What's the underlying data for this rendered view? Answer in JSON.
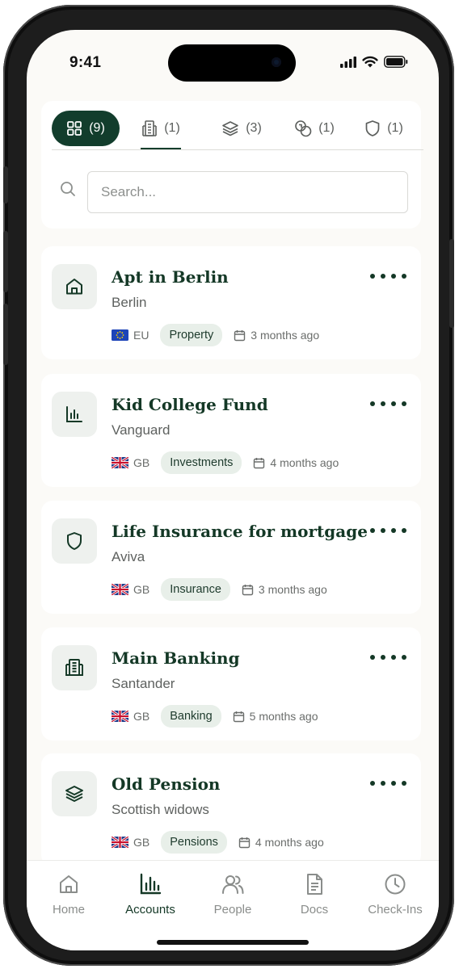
{
  "status_bar": {
    "time": "9:41"
  },
  "tabs": [
    {
      "icon": "grid-icon",
      "count": "(9)",
      "active": true
    },
    {
      "icon": "bank-icon",
      "count": "(1)",
      "active": false
    },
    {
      "icon": "layers-icon",
      "count": "(3)",
      "active": false
    },
    {
      "icon": "coins-icon",
      "count": "(1)",
      "active": false
    },
    {
      "icon": "shield-icon",
      "count": "(1)",
      "active": false
    }
  ],
  "search": {
    "placeholder": "Search..."
  },
  "accounts": [
    {
      "icon": "home-icon",
      "title": "Apt in Berlin",
      "provider": "Berlin",
      "region_flag": "eu-flag-icon",
      "region": "EU",
      "tag": "Property",
      "updated": "3 months ago"
    },
    {
      "icon": "chart-icon",
      "title": "Kid College Fund",
      "provider": "Vanguard",
      "region_flag": "gb-flag-icon",
      "region": "GB",
      "tag": "Investments",
      "updated": "4 months ago"
    },
    {
      "icon": "shield-icon",
      "title": "Life Insurance for mortgage",
      "provider": "Aviva",
      "region_flag": "gb-flag-icon",
      "region": "GB",
      "tag": "Insurance",
      "updated": "3 months ago"
    },
    {
      "icon": "bank-icon",
      "title": "Main Banking",
      "provider": "Santander",
      "region_flag": "gb-flag-icon",
      "region": "GB",
      "tag": "Banking",
      "updated": "5 months ago"
    },
    {
      "icon": "layers-icon",
      "title": "Old Pension",
      "provider": "Scottish widows",
      "region_flag": "gb-flag-icon",
      "region": "GB",
      "tag": "Pensions",
      "updated": "4 months ago"
    }
  ],
  "bottom_nav": [
    {
      "icon": "home-icon",
      "label": "Home",
      "active": false
    },
    {
      "icon": "chart-icon",
      "label": "Accounts",
      "active": true
    },
    {
      "icon": "people-icon",
      "label": "People",
      "active": false
    },
    {
      "icon": "document-icon",
      "label": "Docs",
      "active": false
    },
    {
      "icon": "clock-icon",
      "label": "Check-Ins",
      "active": false
    }
  ],
  "colors": {
    "brand": "#123d2c",
    "tag_bg": "#e8efe9",
    "screen_bg": "#fbfaf7"
  }
}
